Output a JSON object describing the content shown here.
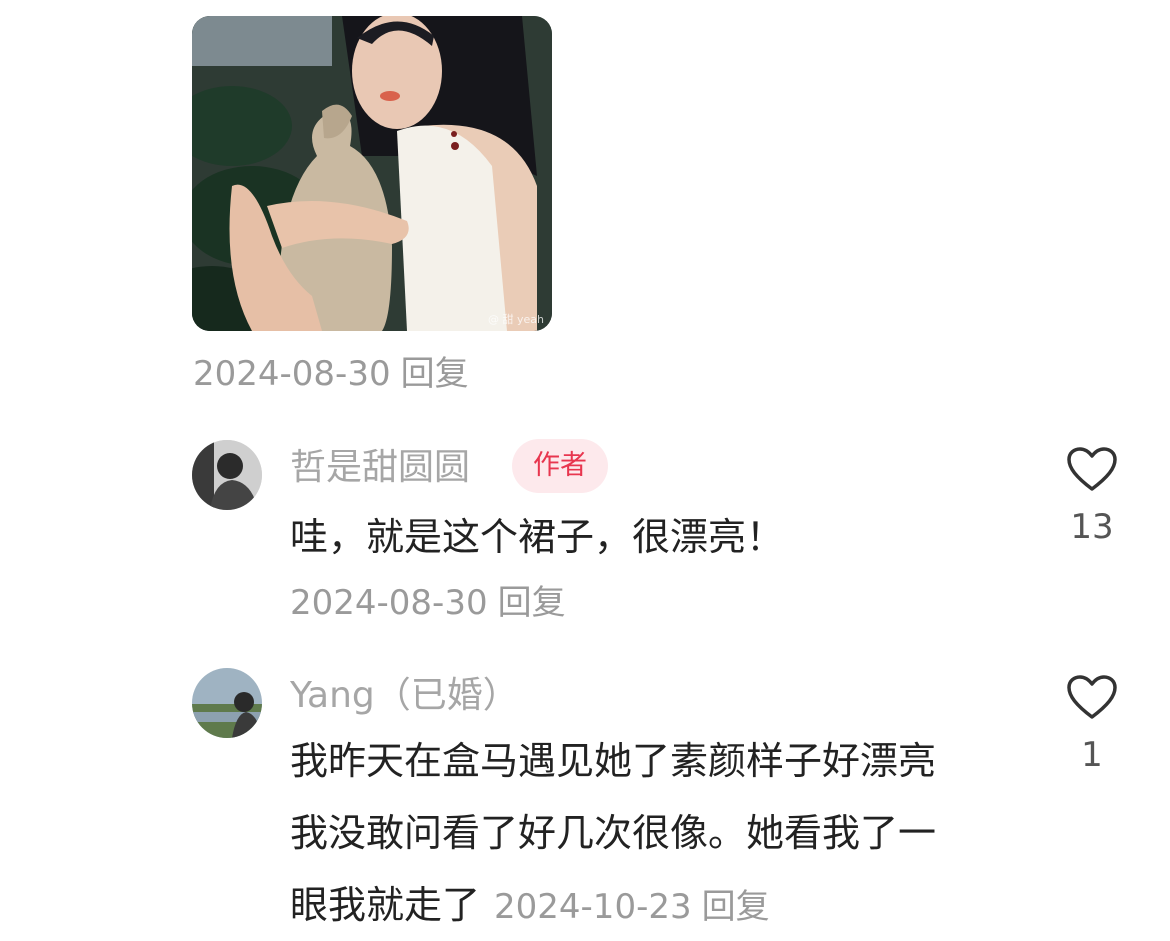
{
  "top_post": {
    "image_watermark": "@ 甜 yeah",
    "date": "2024-08-30",
    "reply_label": "回复"
  },
  "comments": [
    {
      "username": "哲是甜圆圆",
      "badge": "作者",
      "text_lines": [
        "哇，就是这个裙子，很漂亮！"
      ],
      "date": "2024-08-30",
      "reply_label": "回复",
      "like_count": "13"
    },
    {
      "username": "Yang（已婚）",
      "text_lines": [
        "我昨天在盒马遇见她了素颜样子好漂亮",
        "我没敢问看了好几次很像。她看我了一",
        "眼我就走了"
      ],
      "date": "2024-10-23",
      "reply_label": "回复",
      "like_count": "1"
    }
  ],
  "icons": {
    "like": "heart-outline-icon"
  },
  "colors": {
    "meta_gray": "#9a9a9a",
    "badge_bg": "#fde9ec",
    "badge_text": "#e8364f",
    "text": "#222222"
  }
}
